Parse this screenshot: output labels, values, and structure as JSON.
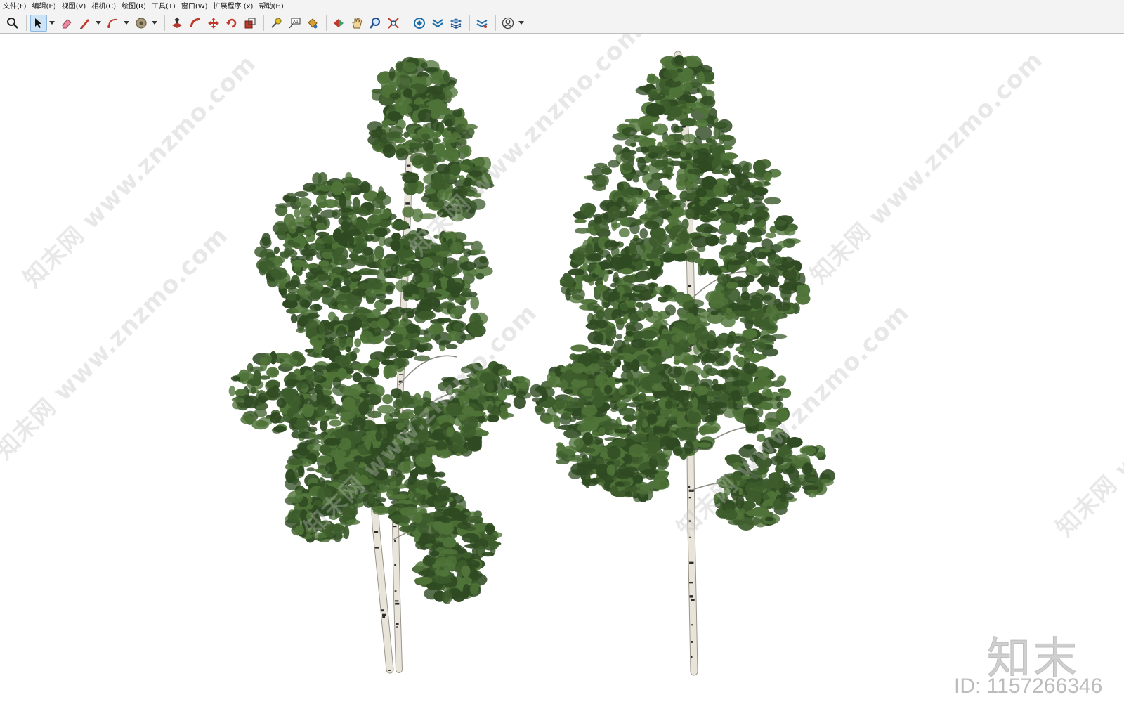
{
  "menu": [
    "文件(F)",
    "编辑(E)",
    "视图(V)",
    "相机(C)",
    "绘图(R)",
    "工具(T)",
    "窗口(W)",
    "扩展程序 (x)",
    "帮助(H)"
  ],
  "toolbar": {
    "icons": [
      "zoom-icon",
      "select-arrow-icon",
      "eraser-icon",
      "pencil-icon",
      "arc-icon",
      "paint-bucket-icon",
      "push-pull-icon",
      "follow-me-icon",
      "move-icon",
      "rotate-icon",
      "scale-icon",
      "tape-measure-icon",
      "text-icon",
      "paint-icon",
      "orbit-icon",
      "pan-icon",
      "zoom-tool-icon",
      "zoom-extents-icon",
      "warehouse-icon",
      "extension-icon",
      "layers-icon",
      "sandbox-icon",
      "account-icon"
    ]
  },
  "watermarks": [
    "知末网 www.znzmo.com"
  ],
  "brand": "知末",
  "image_id": "ID: 1157266346",
  "colors": {
    "foliage_dark": "#2f4a22",
    "foliage_mid": "#3d5c2c",
    "foliage_light": "#4f7338",
    "bark": "#e8e4da",
    "bark_mark": "#2a2a2a"
  }
}
